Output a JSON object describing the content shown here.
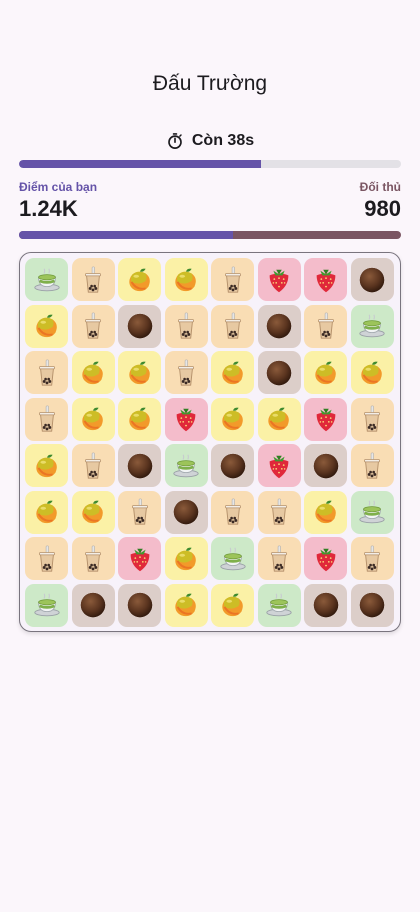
{
  "header": {
    "title": "Đấu Trường"
  },
  "timer": {
    "label": "Còn 38s",
    "remaining_fraction": 0.634
  },
  "scores": {
    "player_label": "Điểm của bạn",
    "player_score": "1.24K",
    "opponent_label": "Đối thủ",
    "opponent_score": "980",
    "player_share": 0.56
  },
  "colors": {
    "primary": "#6553a8",
    "opponent": "#7a5562",
    "track": "#e3e1e6",
    "background": "#fbf6fb"
  },
  "board": {
    "rows": 8,
    "cols": 8,
    "tile_types": {
      "tea": {
        "icon": "green-tea-icon",
        "color": "#cde9c8"
      },
      "boba": {
        "icon": "bubble-tea-icon",
        "color": "#f9ddb4"
      },
      "mango": {
        "icon": "mango-icon",
        "color": "#fbf1a6"
      },
      "coco": {
        "icon": "coconut-icon",
        "color": "#dccec9"
      },
      "straw": {
        "icon": "strawberry-icon",
        "color": "#f4bccb"
      }
    },
    "grid": [
      [
        "tea",
        "boba",
        "mango",
        "mango",
        "boba",
        "straw",
        "straw",
        "coco"
      ],
      [
        "mango",
        "boba",
        "coco",
        "boba",
        "boba",
        "coco",
        "boba",
        "tea"
      ],
      [
        "boba",
        "mango",
        "mango",
        "boba",
        "mango",
        "coco",
        "mango",
        "mango"
      ],
      [
        "boba",
        "mango",
        "mango",
        "straw",
        "mango",
        "mango",
        "straw",
        "boba"
      ],
      [
        "mango",
        "boba",
        "coco",
        "tea",
        "coco",
        "straw",
        "coco",
        "boba"
      ],
      [
        "mango",
        "mango",
        "boba",
        "coco",
        "boba",
        "boba",
        "mango",
        "tea"
      ],
      [
        "boba",
        "boba",
        "straw",
        "mango",
        "tea",
        "boba",
        "straw",
        "boba"
      ],
      [
        "tea",
        "coco",
        "coco",
        "mango",
        "mango",
        "tea",
        "coco",
        "coco"
      ]
    ]
  }
}
